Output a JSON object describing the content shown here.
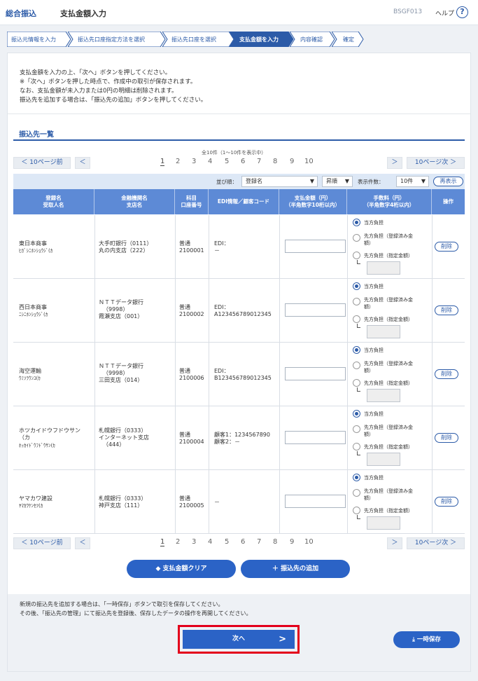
{
  "header": {
    "title": "総合振込",
    "subtitle": "支払金額入力",
    "screen_code": "BSGF013",
    "help_label": "ヘルプ",
    "help_icon": "?"
  },
  "steps": [
    {
      "label": "振込元情報を入力",
      "active": false
    },
    {
      "label": "振込先口座指定方法を選択",
      "active": false
    },
    {
      "label": "振込先口座を選択",
      "active": false
    },
    {
      "label": "支払金額を入力",
      "active": true
    },
    {
      "label": "内容確認",
      "active": false
    },
    {
      "label": "確定",
      "active": false
    }
  ],
  "intro": [
    "支払金額を入力の上、「次へ」ボタンを押してください。",
    "※「次へ」ボタンを押した時点で、作成中の取引が保存されます。",
    "なお、支払金額が未入力または0円の明細は削除されます。",
    "振込先を追加する場合は、「振込先の追加」ボタンを押してください。"
  ],
  "section_title": "振込先一覧",
  "pagination": {
    "count_text": "全10件（1〜10件を表示中）",
    "prev10": "10ページ前",
    "next10": "10ページ次",
    "prev_arrow": "＜",
    "next_arrow": "＞",
    "pages": [
      "1",
      "2",
      "3",
      "4",
      "5",
      "6",
      "7",
      "8",
      "9",
      "10"
    ]
  },
  "sort": {
    "label": "並び順：",
    "field": "登録名",
    "order": "昇順",
    "per_page_label": "表示件数：",
    "per_page": "10件",
    "redisplay": "再表示"
  },
  "columns": {
    "name": [
      "登録名",
      "受取人名"
    ],
    "bank": [
      "金融機関名",
      "支店名"
    ],
    "account": [
      "科目",
      "口座番号"
    ],
    "edi": "EDI情報／顧客コード",
    "amount": [
      "支払金額（円）",
      "（半角数字10桁以内）"
    ],
    "fee": [
      "手数料（円）",
      "（半角数字4桁以内）"
    ],
    "op": "操作"
  },
  "fee_options": [
    "当方負担",
    "先方負担（登録済み金",
    "額）",
    "先方負担（指定金額）"
  ],
  "delete_label": "削除",
  "rows": [
    {
      "name": "東日本商事",
      "kana": "ﾋｶﾞｼﾆﾎﾝｼｮｳｼﾞ(ｶ",
      "bank1": "大手町銀行（0111）",
      "bank2": "丸の内支店（222）",
      "bank3": "",
      "type": "普通",
      "acct": "2100001",
      "edi1": "EDI：",
      "edi2": "－"
    },
    {
      "name": "西日本商事",
      "kana": "ﾆｼﾆﾎﾝｼｮｳｼﾞ(ｶ",
      "bank1": "ＮＴＴデータ銀行",
      "bank2": "（9998）",
      "bank3": "霞瀬支店（001）",
      "type": "普通",
      "acct": "2100002",
      "edi1": "EDI：",
      "edi2": "A123456789012345"
    },
    {
      "name": "海空運輸",
      "kana": "ｳﾐｿﾗｳﾝﾕ(ｶ",
      "bank1": "ＮＴＴデータ銀行",
      "bank2": "（9998）",
      "bank3": "三田支店（014）",
      "type": "普通",
      "acct": "2100006",
      "edi1": "EDI：",
      "edi2": "B123456789012345"
    },
    {
      "name": "ホツカイドウフドウサン",
      "kana": "ﾎｯｶｲﾄﾞｳﾌﾄﾞｳｻﾝ(ｶ",
      "name2": "（カ",
      "bank1": "札幌銀行（0333）",
      "bank2": "インターネット支店",
      "bank3": "（444）",
      "type": "普通",
      "acct": "2100004",
      "edi1": "顧客1：1234567890",
      "edi2": "顧客2：－"
    },
    {
      "name": "ヤマカワ建設",
      "kana": "ﾔﾏｶﾜｹﾝｾﾂ(ｶ",
      "bank1": "札幌銀行（0333）",
      "bank2": "神戸支店（111）",
      "bank3": "",
      "type": "普通",
      "acct": "2100005",
      "edi1": "－",
      "edi2": ""
    }
  ],
  "actions": {
    "clear": "支払金額クリア",
    "add": "振込先の追加"
  },
  "footer": {
    "note1": "新規の振込先を追加する場合は、「一時保存」ボタンで取引を保存してください。",
    "note2": "その後、「振込先の管理」にて振込先を登録後、保存したデータの操作を再開してください。",
    "next": "次へ",
    "save": "一時保存"
  }
}
